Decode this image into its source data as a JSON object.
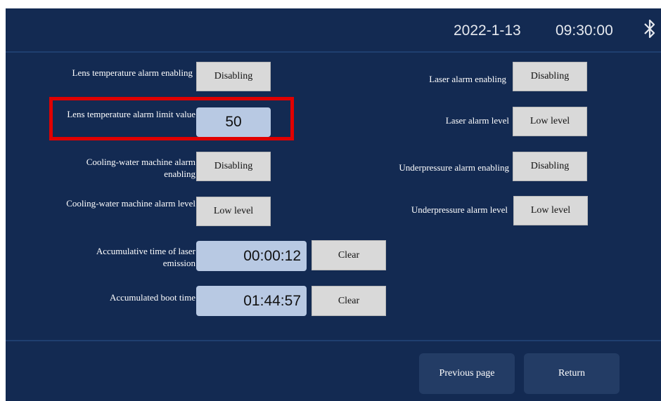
{
  "header": {
    "date": "2022-1-13",
    "time": "09:30:00",
    "bluetooth_icon": "bluetooth-icon"
  },
  "left": {
    "lens_enable_label": "Lens temperature alarm enabling",
    "lens_enable_value": "Disabling",
    "lens_limit_label": "Lens temperature alarm limit value",
    "lens_limit_value": "50",
    "cooling_enable_label": "Cooling-water machine alarm enabling",
    "cooling_enable_value": "Disabling",
    "cooling_level_label": "Cooling-water machine alarm level",
    "cooling_level_value": "Low level",
    "laser_time_label": "Accumulative time of laser emission",
    "laser_time_value": "00:00:12",
    "boot_time_label": "Accumulated boot time",
    "boot_time_value": "01:44:57",
    "clear_label": "Clear"
  },
  "right": {
    "laser_enable_label": "Laser alarm enabling",
    "laser_enable_value": "Disabling",
    "laser_level_label": "Laser alarm level",
    "laser_level_value": "Low level",
    "under_enable_label": "Underpressure alarm enabling",
    "under_enable_value": "Disabling",
    "under_level_label": "Underpressure alarm level",
    "under_level_value": "Low level"
  },
  "footer": {
    "previous_label": "Previous page",
    "return_label": "Return"
  },
  "colors": {
    "background": "#132a52",
    "highlight": "#e00000",
    "value_field": "#b8c9e3",
    "button": "#d9d9d9"
  }
}
